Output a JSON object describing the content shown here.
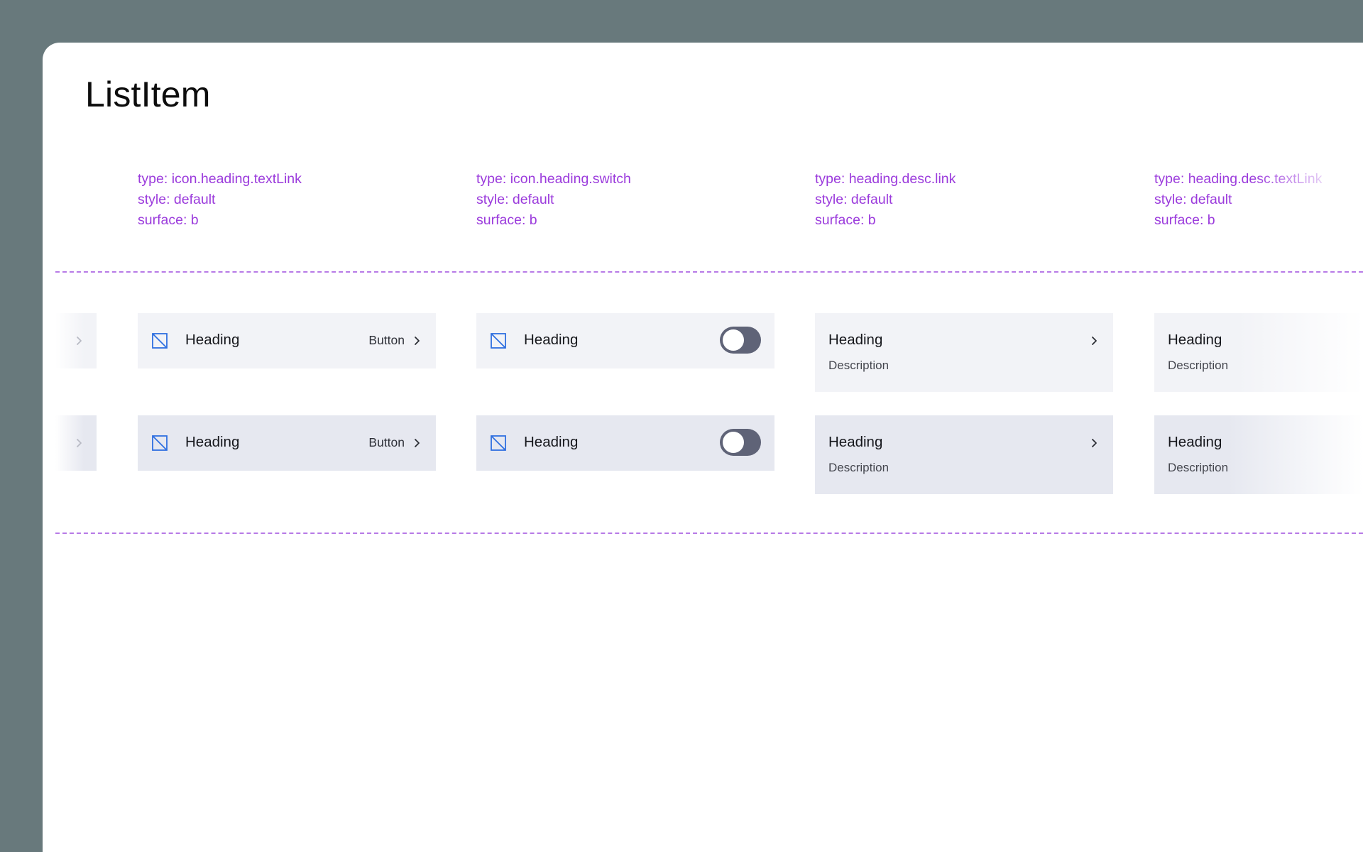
{
  "page": {
    "title": "ListItem"
  },
  "columns": [
    {
      "spec": [
        "type: icon.heading.textLink",
        "style: default",
        "surface: b"
      ],
      "rows": [
        {
          "heading": "Heading",
          "text_link": "Button"
        },
        {
          "heading": "Heading",
          "text_link": "Button"
        }
      ]
    },
    {
      "spec": [
        "type: icon.heading.switch",
        "style: default",
        "surface: b"
      ],
      "rows": [
        {
          "heading": "Heading",
          "switch_on": false
        },
        {
          "heading": "Heading",
          "switch_on": false
        }
      ]
    },
    {
      "spec": [
        "type: heading.desc.link",
        "style: default",
        "surface: b"
      ],
      "rows": [
        {
          "heading": "Heading",
          "description": "Description"
        },
        {
          "heading": "Heading",
          "description": "Description"
        }
      ]
    },
    {
      "spec": [
        "type: heading.desc.textLink",
        "style: default",
        "surface: b"
      ],
      "rows": [
        {
          "heading": "Heading",
          "description": "Description"
        },
        {
          "heading": "Heading",
          "description": "Description"
        }
      ]
    }
  ],
  "colors": {
    "backdrop": "#68797c",
    "panel": "#ffffff",
    "spec_text": "#9b3bdc",
    "divider": "#b77ae6",
    "surface_row1": "#f2f3f7",
    "surface_row2": "#e6e8f0",
    "icon_blue": "#2f6fe0",
    "switch_track": "#5f6377"
  },
  "icons": {
    "placeholder": "placeholder-square-slash-icon",
    "chevron": "chevron-right-icon"
  }
}
